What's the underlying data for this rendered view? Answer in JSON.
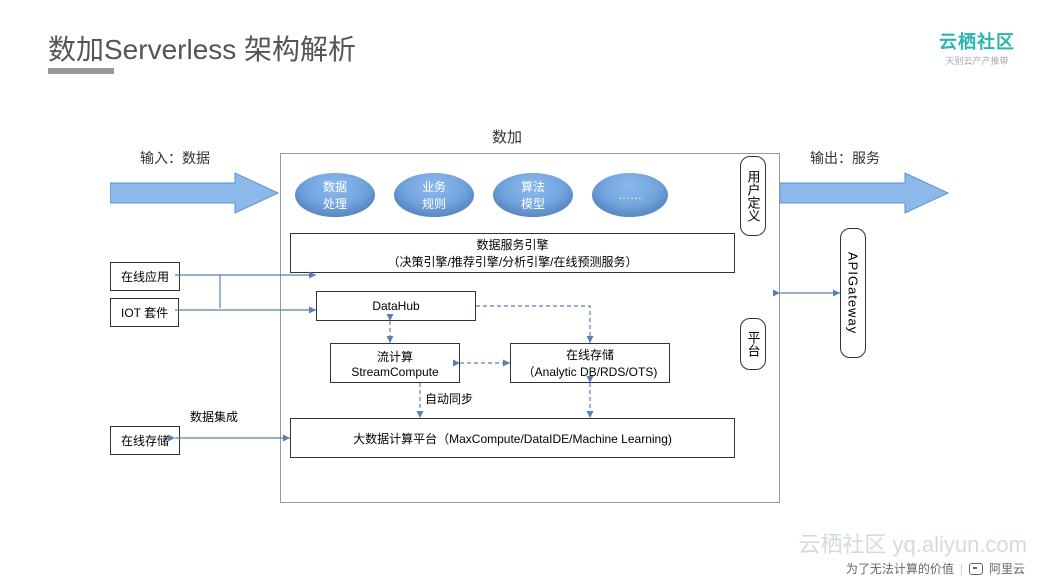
{
  "title": "数加Serverless 架构解析",
  "logo": {
    "main": "云栖社区",
    "sub": "天别云产产推带"
  },
  "footer": {
    "tagline": "为了无法计算的价值",
    "brand": "阿里云"
  },
  "watermark": "云栖社区 yq.aliyun.com",
  "diagram": {
    "container_title": "数加",
    "input_label": "输入：数据",
    "output_label": "输出：服务",
    "bubbles": [
      "数据\n处理",
      "业务\n规则",
      "算法\n模型",
      "……"
    ],
    "vlabels": {
      "user_defined": "用户定义",
      "platform": "平台",
      "gateway": "APIGateway"
    },
    "service_engine": {
      "title": "数据服务引擎",
      "sub": "（决策引擎/推荐引擎/分析引擎/在线预测服务）"
    },
    "datahub": "DataHub",
    "stream": {
      "zh": "流计算",
      "en": "StreamCompute"
    },
    "storage": {
      "zh": "在线存储",
      "en": "（Analytic DB/RDS/OTS)"
    },
    "compute": "大数据计算平台（MaxCompute/DataIDE/Machine Learning)",
    "ext": {
      "online_app": "在线应用",
      "iot": "IOT 套件",
      "online_storage": "在线存储",
      "integration": "数据集成"
    },
    "sync": "自动同步"
  }
}
